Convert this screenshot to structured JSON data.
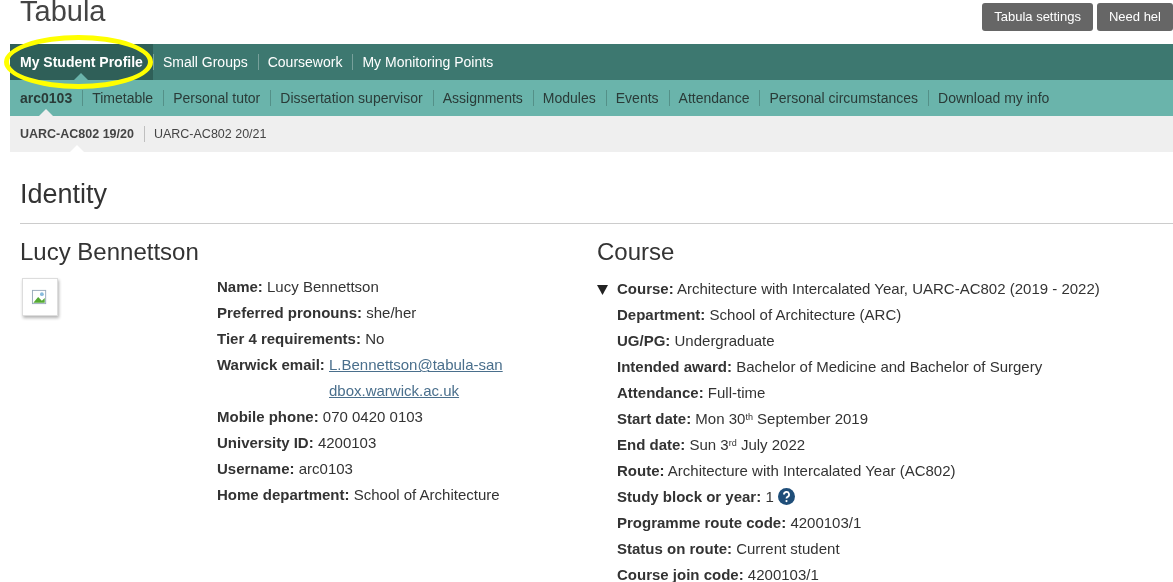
{
  "app_title": "Tabula",
  "header_buttons": [
    "Tabula settings",
    "Need hel"
  ],
  "primary_nav": [
    {
      "label": "My Student Profile",
      "selected": true,
      "highlighted": true
    },
    {
      "label": "Small Groups",
      "selected": false,
      "highlighted": false
    },
    {
      "label": "Coursework",
      "selected": false,
      "highlighted": false
    },
    {
      "label": "My Monitoring Points",
      "selected": false,
      "highlighted": false
    }
  ],
  "secondary_nav": [
    {
      "label": "arc0103",
      "selected": true
    },
    {
      "label": "Timetable",
      "selected": false
    },
    {
      "label": "Personal tutor",
      "selected": false
    },
    {
      "label": "Dissertation supervisor",
      "selected": false
    },
    {
      "label": "Assignments",
      "selected": false
    },
    {
      "label": "Modules",
      "selected": false
    },
    {
      "label": "Events",
      "selected": false
    },
    {
      "label": "Attendance",
      "selected": false
    },
    {
      "label": "Personal circumstances",
      "selected": false
    },
    {
      "label": "Download my info",
      "selected": false
    }
  ],
  "course_tabs": [
    {
      "label": "UARC-AC802 19/20",
      "selected": true
    },
    {
      "label": "UARC-AC802 20/21",
      "selected": false
    }
  ],
  "section_title": "Identity",
  "student": {
    "heading": "Lucy Bennettson",
    "fields": [
      {
        "label": "Name:",
        "value": "Lucy Bennettson",
        "kind": "text"
      },
      {
        "label": "Preferred pronouns:",
        "value": "she/her",
        "kind": "text"
      },
      {
        "label": "Tier 4 requirements:",
        "value": "No",
        "kind": "text"
      },
      {
        "label": "Warwick email:",
        "value": "L.Bennettson@tabula-sandbox.warwick.ac.uk",
        "kind": "link"
      },
      {
        "label": "Mobile phone:",
        "value": "070 0420 0103",
        "kind": "text"
      },
      {
        "label": "University ID:",
        "value": "4200103",
        "kind": "text"
      },
      {
        "label": "Username:",
        "value": "arc0103",
        "kind": "text"
      },
      {
        "label": "Home department:",
        "value": "School of Architecture",
        "kind": "text"
      }
    ]
  },
  "course": {
    "heading": "Course",
    "expanded": true,
    "summary": {
      "label": "Course:",
      "value": "Architecture with Intercalated Year, UARC-AC802 (2019 - 2022)"
    },
    "fields": [
      {
        "label": "Department:",
        "value": "School of Architecture (ARC)",
        "kind": "text"
      },
      {
        "label": "UG/PG:",
        "value": "Undergraduate",
        "kind": "text"
      },
      {
        "label": "Intended award:",
        "value": "Bachelor of Medicine and Bachelor of Surgery",
        "kind": "text"
      },
      {
        "label": "Attendance:",
        "value": "Full-time",
        "kind": "text"
      },
      {
        "label": "Start date:",
        "value": "Mon 30$^{th}$ September 2019",
        "kind": "text"
      },
      {
        "label": "End date:",
        "value": "Sun 3$^{rd}$ July 2022",
        "kind": "text"
      },
      {
        "label": "Route:",
        "value": "Architecture with Intercalated Year (AC802)",
        "kind": "text"
      },
      {
        "label": "Study block or year:",
        "value": "1",
        "kind": "help"
      },
      {
        "label": "Programme route code:",
        "value": "4200103/1",
        "kind": "text"
      },
      {
        "label": "Status on route:",
        "value": "Current student",
        "kind": "text"
      },
      {
        "label": "Course join code:",
        "value": "4200103/1",
        "kind": "text"
      }
    ]
  }
}
